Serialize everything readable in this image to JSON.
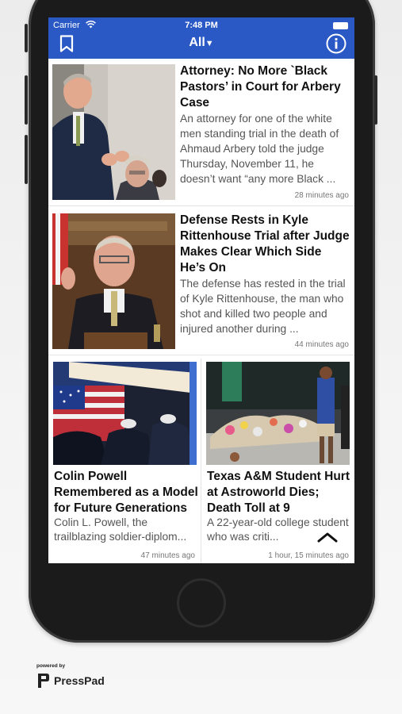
{
  "status_bar": {
    "carrier": "Carrier",
    "time": "7:48 PM"
  },
  "nav": {
    "feed_selector": "All",
    "bookmark_icon": "bookmark-icon",
    "info_icon": "info-icon"
  },
  "articles": [
    {
      "headline": "Attorney: No More `Black Pastors’ in Court for Arbery Case",
      "excerpt": "An attorney for one of the white men standing trial in the death of Ahmaud Arbery told the judge Thursday, November 11, he doesn’t want “any more Black ...",
      "timestamp": "28 minutes ago"
    },
    {
      "headline": "Defense Rests in Kyle Rittenhouse Trial after Judge Makes Clear Which Side He’s On",
      "excerpt": "The defense has rested in the trial of Kyle Rittenhouse, the man who shot and killed two people and injured another during ...",
      "timestamp": "44 minutes ago"
    }
  ],
  "grid_articles": [
    {
      "headline": "Colin Powell Remembered as a Model for Future Generations",
      "excerpt": "Colin L. Powell, the trailblazing soldier-diplom...",
      "timestamp": "47 minutes ago"
    },
    {
      "headline": "Texas A&M Student Hurt at Astroworld Dies; Death Toll at 9",
      "excerpt": "A 22-year-old college student who was criti...",
      "timestamp": "1 hour, 15 minutes ago"
    }
  ],
  "branding": {
    "powered_by": "powered by",
    "name": "PressPad"
  },
  "colors": {
    "nav_bar": "#2a59c6",
    "phone_body": "#1b1b1b"
  }
}
